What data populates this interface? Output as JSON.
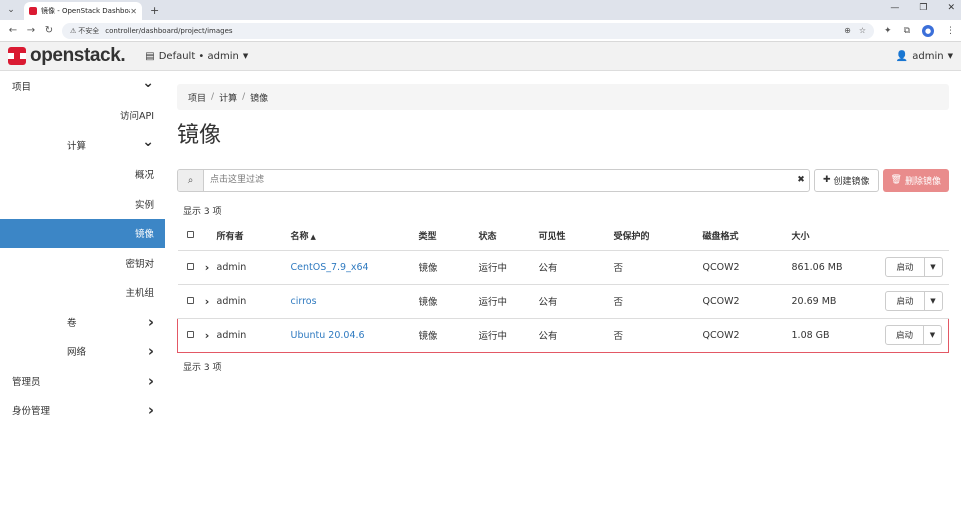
{
  "browser": {
    "tab_title": "镜像 - OpenStack Dashboard",
    "new_tab_icon": "plus-icon",
    "insecure_label": "不安全",
    "url": "controller/dashboard/project/images"
  },
  "header": {
    "logo_text": "openstack.",
    "project": "Default • admin",
    "user": "admin"
  },
  "sidebar": {
    "items": [
      {
        "label": "项目",
        "level": 0,
        "chevron": "down"
      },
      {
        "label": "访问API",
        "level": 2
      },
      {
        "label": "计算",
        "level": 1,
        "chevron": "down"
      },
      {
        "label": "概况",
        "level": 2
      },
      {
        "label": "实例",
        "level": 2
      },
      {
        "label": "镜像",
        "level": 2,
        "active": true
      },
      {
        "label": "密钥对",
        "level": 2
      },
      {
        "label": "主机组",
        "level": 2
      },
      {
        "label": "卷",
        "level": 1,
        "chevron": "right"
      },
      {
        "label": "网络",
        "level": 1,
        "chevron": "right"
      },
      {
        "label": "管理员",
        "level": 0,
        "chevron": "right"
      },
      {
        "label": "身份管理",
        "level": 0,
        "chevron": "right"
      }
    ]
  },
  "breadcrumb": [
    "项目",
    "计算",
    "镜像"
  ],
  "page_title": "镜像",
  "filter": {
    "placeholder": "点击这里过滤",
    "create_label": "创建镜像",
    "delete_label": "删除镜像"
  },
  "count_label": "显示 3 项",
  "table": {
    "columns": [
      "所有者",
      "名称",
      "类型",
      "状态",
      "可见性",
      "受保护的",
      "磁盘格式",
      "大小"
    ],
    "rows": [
      {
        "owner": "admin",
        "name": "CentOS_7.9_x64",
        "type": "镜像",
        "status": "运行中",
        "visibility": "公有",
        "protected": "否",
        "format": "QCOW2",
        "size": "861.06 MB",
        "highlight": false
      },
      {
        "owner": "admin",
        "name": "cirros",
        "type": "镜像",
        "status": "运行中",
        "visibility": "公有",
        "protected": "否",
        "format": "QCOW2",
        "size": "20.69 MB",
        "highlight": false
      },
      {
        "owner": "admin",
        "name": "Ubuntu 20.04.6",
        "type": "镜像",
        "status": "运行中",
        "visibility": "公有",
        "protected": "否",
        "format": "QCOW2",
        "size": "1.08 GB",
        "highlight": true
      }
    ],
    "launch_label": "启动"
  },
  "colors": {
    "active_nav": "#3c86c6",
    "link": "#2f7ac0",
    "delete_button": "#e98c8c",
    "highlight_border": "#e35865",
    "brand_red": "#da1a32"
  }
}
